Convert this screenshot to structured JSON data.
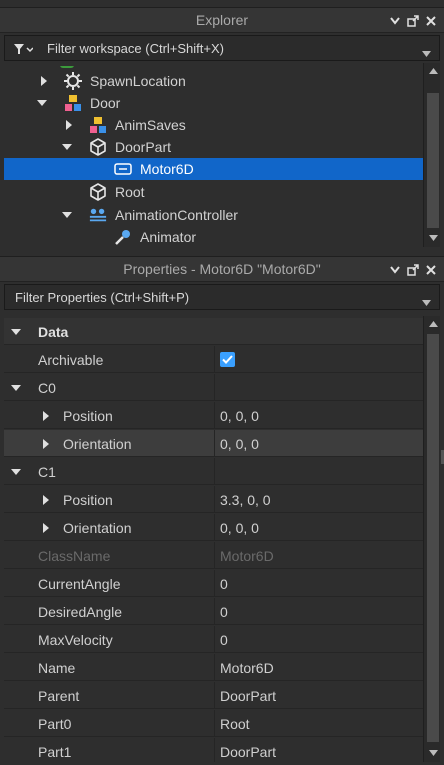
{
  "explorer": {
    "title": "Explorer",
    "filter_placeholder": "Filter workspace (Ctrl+Shift+X)",
    "items": [
      {
        "label": "SpawnLocation",
        "icon": "gear-icon",
        "expanded": false
      },
      {
        "label": "Door",
        "icon": "model-icon",
        "expanded": true
      },
      {
        "label": "AnimSaves",
        "icon": "model-icon",
        "expanded": false
      },
      {
        "label": "DoorPart",
        "icon": "part-icon",
        "expanded": true
      },
      {
        "label": "Motor6D",
        "icon": "motor6d-icon",
        "selected": true
      },
      {
        "label": "Root",
        "icon": "part-icon"
      },
      {
        "label": "AnimationController",
        "icon": "animation-controller-icon",
        "expanded": true
      },
      {
        "label": "Animator",
        "icon": "animator-icon"
      }
    ]
  },
  "properties": {
    "title": "Properties - Motor6D \"Motor6D\"",
    "filter_placeholder": "Filter Properties (Ctrl+Shift+P)",
    "section": "Data",
    "rows": [
      {
        "name": "Archivable",
        "value": "",
        "checked": true
      },
      {
        "name": "C0",
        "value": ""
      },
      {
        "name": "Position",
        "value": "0, 0, 0"
      },
      {
        "name": "Orientation",
        "value": "0, 0, 0"
      },
      {
        "name": "C1",
        "value": ""
      },
      {
        "name": "Position",
        "value": "3.3, 0, 0"
      },
      {
        "name": "Orientation",
        "value": "0, 0, 0"
      },
      {
        "name": "ClassName",
        "value": "Motor6D"
      },
      {
        "name": "CurrentAngle",
        "value": "0"
      },
      {
        "name": "DesiredAngle",
        "value": "0"
      },
      {
        "name": "MaxVelocity",
        "value": "0"
      },
      {
        "name": "Name",
        "value": "Motor6D"
      },
      {
        "name": "Parent",
        "value": "DoorPart"
      },
      {
        "name": "Part0",
        "value": "Root"
      },
      {
        "name": "Part1",
        "value": "DoorPart"
      }
    ]
  },
  "colors": {
    "selection": "#1166c9",
    "checkbox": "#3aa0ff",
    "background": "#2e2e2e"
  }
}
